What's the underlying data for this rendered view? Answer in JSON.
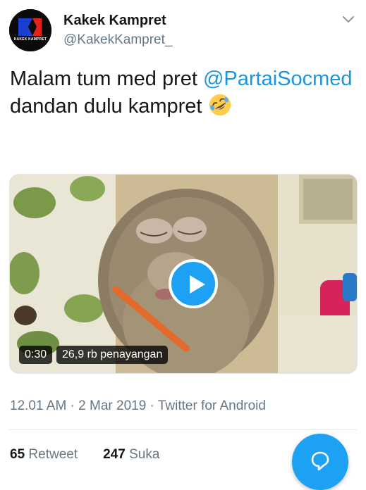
{
  "author": {
    "display_name": "Kakek Kampret",
    "handle": "@KakekKampret_",
    "avatar_text": "KAKEK KAMPRET"
  },
  "tweet": {
    "text_part1": "Malam tum med pret ",
    "mention": "@PartaiSocmed",
    "text_part2": " dandan dulu kampret ",
    "emoji": "rolling-on-floor-laughing-emoji"
  },
  "video": {
    "duration": "0:30",
    "views": "26,9 rb penayangan"
  },
  "meta": {
    "line": "12.01 AM · 2 Mar 2019 · Twitter for Android"
  },
  "stats": {
    "retweet_count": "65",
    "retweet_label": "Retweet",
    "like_count": "247",
    "like_label": "Suka"
  },
  "colors": {
    "accent": "#1da1f2",
    "mention": "#1b95e0",
    "secondary_text": "#657786"
  }
}
